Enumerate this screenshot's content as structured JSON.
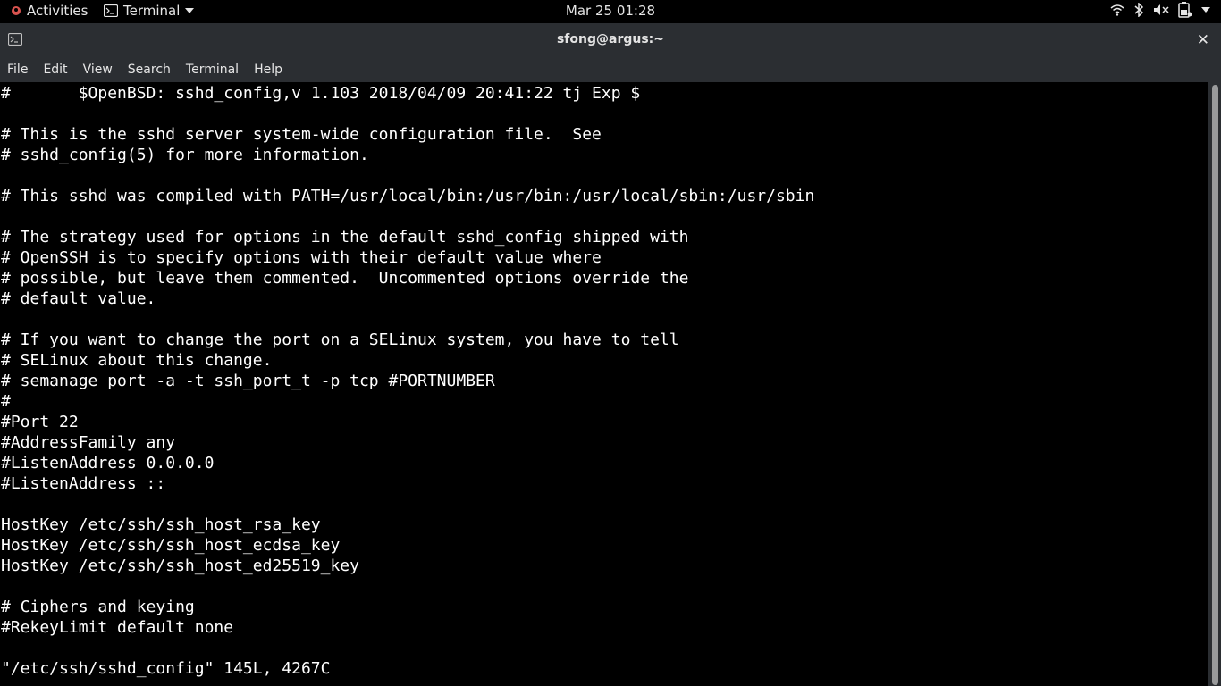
{
  "topbar": {
    "activities_label": "Activities",
    "app_label": "Terminal",
    "clock": "Mar 25  01:28",
    "icons": [
      "wifi-icon",
      "bluetooth-icon",
      "volume-muted-icon",
      "battery-icon",
      "chevron-down-icon"
    ]
  },
  "window": {
    "title": "sfong@argus:~",
    "close_glyph": "✕"
  },
  "menubar": {
    "items": [
      "File",
      "Edit",
      "View",
      "Search",
      "Terminal",
      "Help"
    ]
  },
  "terminal": {
    "lines": [
      "#       $OpenBSD: sshd_config,v 1.103 2018/04/09 20:41:22 tj Exp $",
      "",
      "# This is the sshd server system-wide configuration file.  See",
      "# sshd_config(5) for more information.",
      "",
      "# This sshd was compiled with PATH=/usr/local/bin:/usr/bin:/usr/local/sbin:/usr/sbin",
      "",
      "# The strategy used for options in the default sshd_config shipped with",
      "# OpenSSH is to specify options with their default value where",
      "# possible, but leave them commented.  Uncommented options override the",
      "# default value.",
      "",
      "# If you want to change the port on a SELinux system, you have to tell",
      "# SELinux about this change.",
      "# semanage port -a -t ssh_port_t -p tcp #PORTNUMBER",
      "#",
      "#Port 22",
      "#AddressFamily any",
      "#ListenAddress 0.0.0.0",
      "#ListenAddress ::",
      "",
      "HostKey /etc/ssh/ssh_host_rsa_key",
      "HostKey /etc/ssh/ssh_host_ecdsa_key",
      "HostKey /etc/ssh/ssh_host_ed25519_key",
      "",
      "# Ciphers and keying",
      "#RekeyLimit default none"
    ],
    "status": "\"/etc/ssh/sshd_config\" 145L, 4267C"
  }
}
